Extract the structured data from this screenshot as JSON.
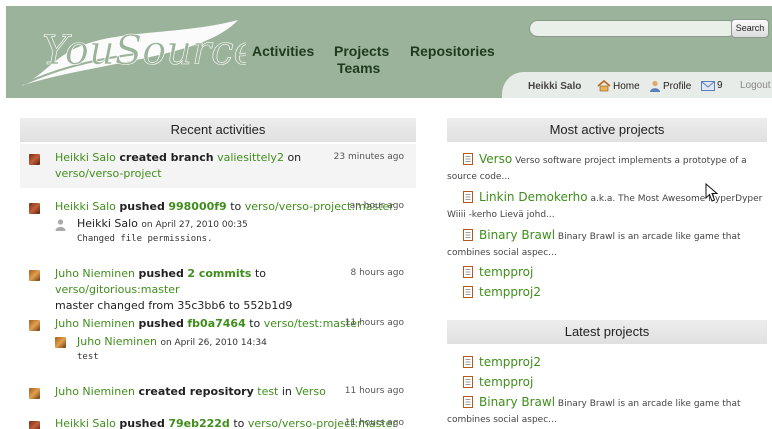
{
  "header": {
    "logo_text": "YouSource",
    "nav": {
      "activities": "Activities",
      "projects": "Projects",
      "teams": "Teams",
      "repositories": "Repositories"
    },
    "search": {
      "button": "Search",
      "value": ""
    },
    "user": {
      "name": "Heikki Salo",
      "home": "Home",
      "profile": "Profile",
      "messages": "9",
      "logout": "Logout"
    }
  },
  "recent": {
    "title": "Recent activities",
    "items": [
      {
        "user": "Heikki Salo",
        "action": "created branch",
        "target": "valiesittely2",
        "on": "on",
        "repo": "verso/verso-project",
        "time": "23 minutes ago"
      },
      {
        "user": "Heikki Salo",
        "action": "pushed",
        "target": "998000f9",
        "on": "to",
        "repo": "verso/verso-project:master",
        "time": "an hour ago",
        "comment": {
          "author": "Heikki Salo",
          "date": "on April 27, 2010 00:35",
          "body": "Changed file permissions."
        }
      },
      {
        "user": "Juho Nieminen",
        "action": "pushed",
        "target": "2 commits",
        "on": "to",
        "repo": "verso/gitorious:master",
        "time": "8 hours ago",
        "detail": "master changed from 35c3bb6 to 552b1d9"
      },
      {
        "user": "Juho Nieminen",
        "action": "pushed",
        "target": "fb0a7464",
        "on": "to",
        "repo": "verso/test:master",
        "time": "11 hours ago",
        "comment": {
          "author": "Juho Nieminen",
          "date": "on April 26, 2010 14:34",
          "body": "test"
        }
      },
      {
        "user": "Juho Nieminen",
        "action": "created repository",
        "target": "test",
        "on": "in",
        "repo": "Verso",
        "time": "11 hours ago"
      },
      {
        "user": "Heikki Salo",
        "action": "pushed",
        "target": "79eb222d",
        "on": "to",
        "repo": "verso/verso-project:master",
        "time": "11 hours ago"
      }
    ]
  },
  "most_active": {
    "title": "Most active projects",
    "items": [
      {
        "name": "Verso",
        "desc": "Verso software project implements a prototype of a",
        "desc2": "source code..."
      },
      {
        "name": "Linkin Demokerho",
        "desc": "a.k.a. The Most Awesome HyperDyper",
        "desc2": "Wiiii -kerho Lievä johd..."
      },
      {
        "name": "Binary Brawl",
        "desc": "Binary Brawl is an arcade like game that",
        "desc2": "combines social aspec..."
      },
      {
        "name": "tempproj",
        "desc": "",
        "desc2": ""
      },
      {
        "name": "tempproj2",
        "desc": "",
        "desc2": ""
      }
    ]
  },
  "latest": {
    "title": "Latest projects",
    "items": [
      {
        "name": "tempproj2",
        "desc": "",
        "desc2": ""
      },
      {
        "name": "tempproj",
        "desc": "",
        "desc2": ""
      },
      {
        "name": "Binary Brawl",
        "desc": "Binary Brawl is an arcade like game that",
        "desc2": "combines social aspec..."
      }
    ]
  },
  "colors": {
    "header": "#9bb39b",
    "link": "#3f8e1c",
    "panel_head": "#e4e4e4"
  }
}
